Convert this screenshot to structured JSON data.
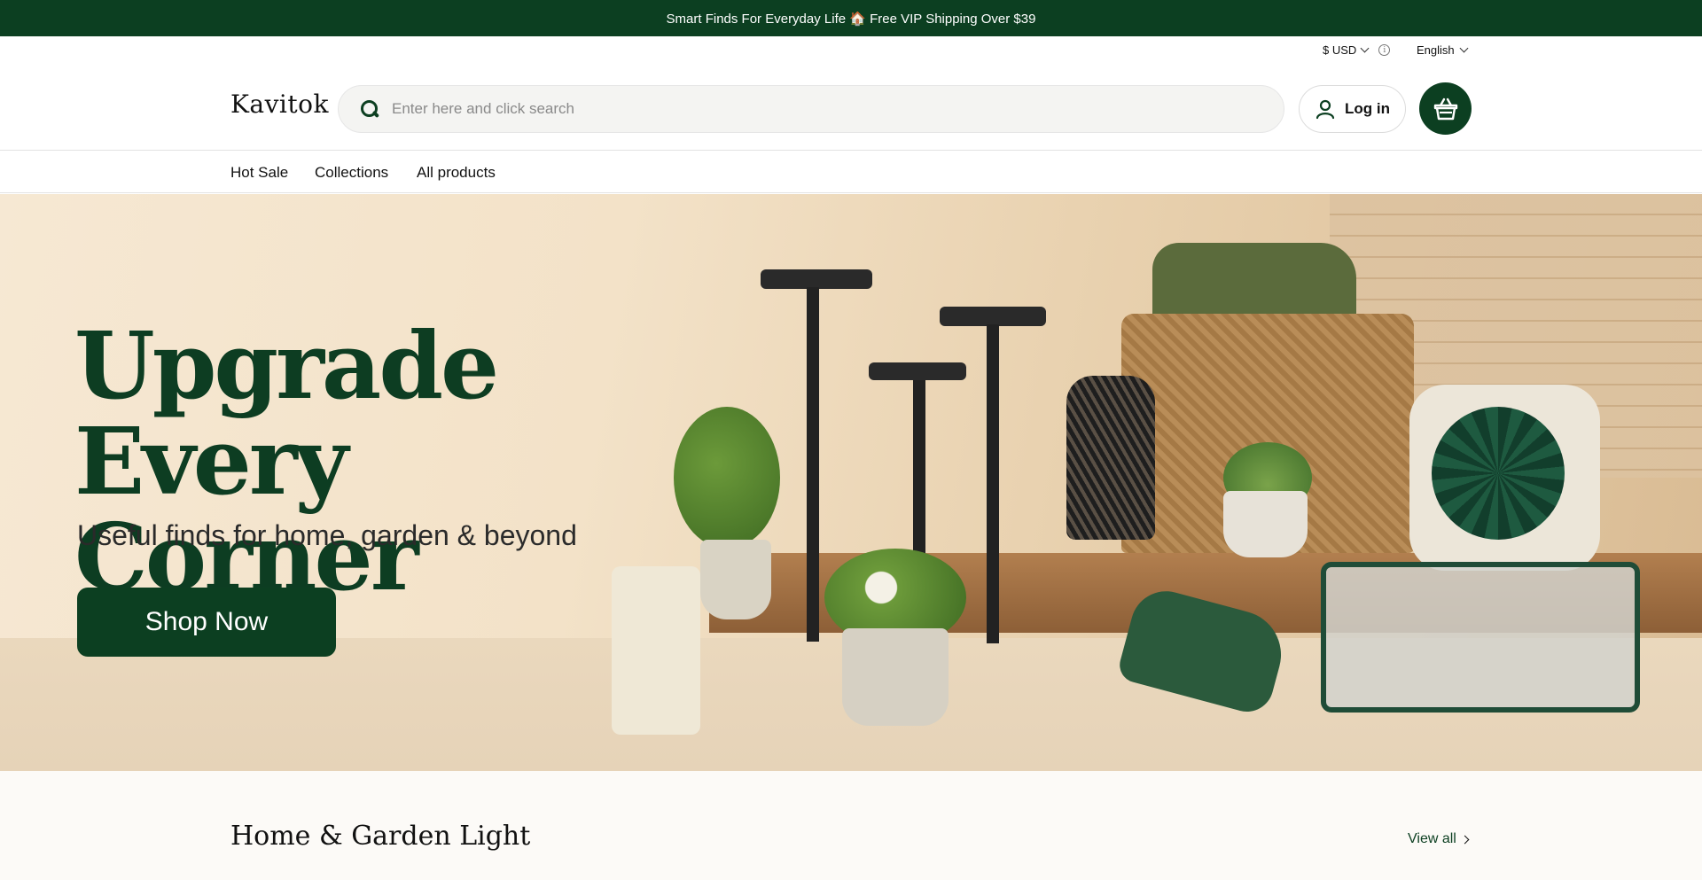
{
  "announcement": {
    "text": "Smart Finds For Everyday Life 🏠 Free VIP Shipping Over $39"
  },
  "utility": {
    "currency": "$ USD",
    "language": "English"
  },
  "header": {
    "logo": "Kavitok",
    "search_placeholder": "Enter here and click search",
    "login_label": "Log in"
  },
  "nav": {
    "items": [
      "Hot Sale",
      "Collections",
      "All products"
    ]
  },
  "hero": {
    "headline": "Upgrade\nEvery Corner",
    "subheadline": "Useful finds for home, garden & beyond",
    "cta_label": "Shop Now"
  },
  "section": {
    "title": "Home & Garden Light",
    "view_all": "View all"
  },
  "colors": {
    "brand": "#0c3f21",
    "headline": "#0d3d22",
    "section_bg": "#fcfaf7"
  }
}
